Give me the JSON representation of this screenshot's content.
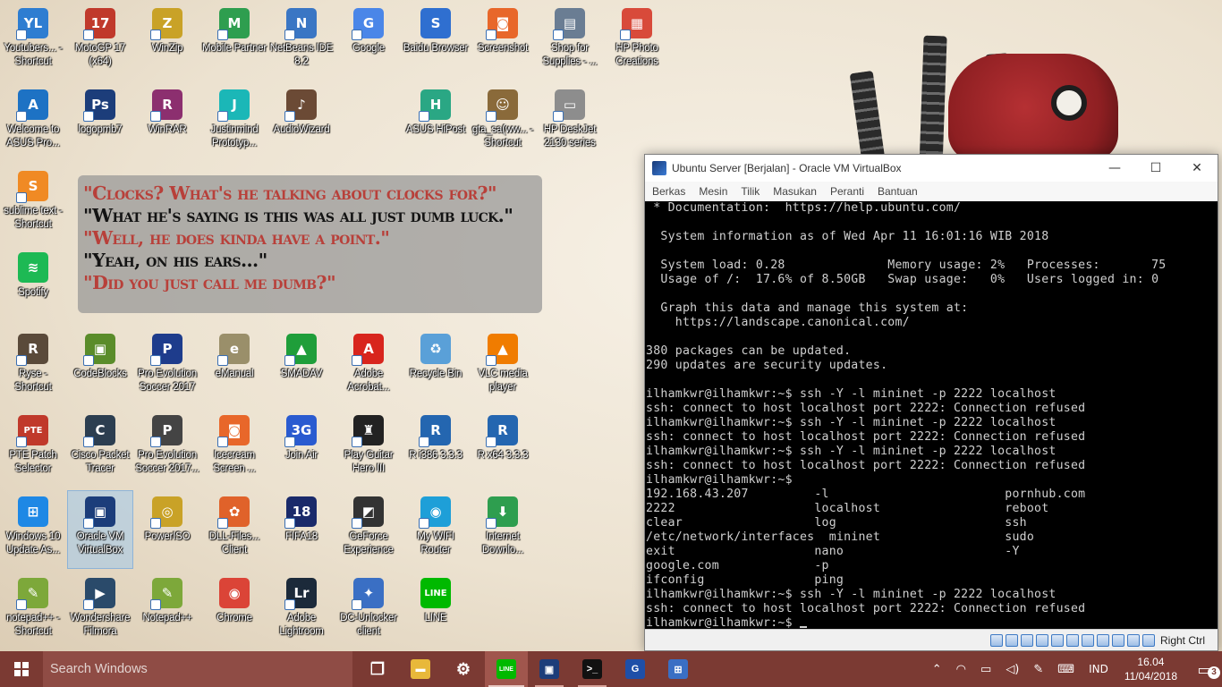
{
  "desktop_icons": [
    {
      "label": "Youtubers... - Shortcut",
      "glyph": "YL",
      "color": "#2e7dd1"
    },
    {
      "label": "MotoGP 17 (x64)",
      "glyph": "17",
      "color": "#c0392b"
    },
    {
      "label": "WinZip",
      "glyph": "Z",
      "color": "#c9a227"
    },
    {
      "label": "Mobile Partner",
      "glyph": "M",
      "color": "#2e9e4f"
    },
    {
      "label": "NetBeans IDE 8.2",
      "glyph": "N",
      "color": "#3a76c4"
    },
    {
      "label": "Google",
      "glyph": "G",
      "color": "#4a86e8"
    },
    {
      "label": "Baidu Browser",
      "glyph": "S",
      "color": "#2f6fd0"
    },
    {
      "label": "Screenshot",
      "glyph": "◙",
      "color": "#e8672a"
    },
    {
      "label": "Shop for Supplies - ...",
      "glyph": "▤",
      "color": "#6a7d93"
    },
    {
      "label": "HP Photo Creations",
      "glyph": "▦",
      "color": "#d84a3a"
    },
    {
      "label": "Welcome to ASUS Pro...",
      "glyph": "A",
      "color": "#1d72c4"
    },
    {
      "label": "logopmb7",
      "glyph": "Ps",
      "color": "#1c3d7a"
    },
    {
      "label": "WinRAR",
      "glyph": "R",
      "color": "#8c2f6f"
    },
    {
      "label": "Justinmind Prototyp...",
      "glyph": "J",
      "color": "#1bb7b7"
    },
    {
      "label": "AudioWizard",
      "glyph": "♪",
      "color": "#6b4a35"
    },
    {
      "label": "ASUS HiPost",
      "glyph": "H",
      "color": "#2aa784"
    },
    {
      "label": "gta_sa(ww... - Shortcut",
      "glyph": "☺",
      "color": "#8a6a3a"
    },
    {
      "label": "HP DeskJet 2130 series",
      "glyph": "▭",
      "color": "#8d8d8d"
    },
    {
      "label": "sublime text - Shortcut",
      "glyph": "S",
      "color": "#f08a24"
    },
    {
      "label": "Spotify",
      "glyph": "≋",
      "color": "#1db954"
    },
    {
      "label": "Ryse - Shortcut",
      "glyph": "R",
      "color": "#5a4a3a"
    },
    {
      "label": "CodeBlocks",
      "glyph": "▣",
      "color": "#5a8c2a"
    },
    {
      "label": "Pro Evolution Soccer 2017",
      "glyph": "P",
      "color": "#1e3c8c"
    },
    {
      "label": "eManual",
      "glyph": "e",
      "color": "#9a8f6a"
    },
    {
      "label": "SMADAV",
      "glyph": "▲",
      "color": "#1f9e3a"
    },
    {
      "label": "Adobe Acrobat...",
      "glyph": "A",
      "color": "#d8251d"
    },
    {
      "label": "Recycle Bin",
      "glyph": "♻",
      "color": "#5aa0d8"
    },
    {
      "label": "VLC media player",
      "glyph": "▲",
      "color": "#f07c00"
    },
    {
      "label": "PTE Patch Selector",
      "glyph": "PTE",
      "color": "#c0392b"
    },
    {
      "label": "Cisco Packet Tracer",
      "glyph": "C",
      "color": "#2c3e50"
    },
    {
      "label": "Pro Evolution Soccer 2017...",
      "glyph": "P",
      "color": "#444"
    },
    {
      "label": "Icecream Screen ...",
      "glyph": "◙",
      "color": "#e8672a"
    },
    {
      "label": "Join Air",
      "glyph": "3G",
      "color": "#2a5bd0"
    },
    {
      "label": "Play Guitar Hero III",
      "glyph": "♜",
      "color": "#222"
    },
    {
      "label": "R i386 3.3.3",
      "glyph": "R",
      "color": "#2466b0"
    },
    {
      "label": "R x64 3.3.3",
      "glyph": "R",
      "color": "#2466b0"
    },
    {
      "label": "Windows 10 Update As...",
      "glyph": "⊞",
      "color": "#1e88e5"
    },
    {
      "label": "Oracle VM VirtualBox",
      "glyph": "▣",
      "color": "#1c3d7a"
    },
    {
      "label": "PowerISO",
      "glyph": "◎",
      "color": "#c9a227"
    },
    {
      "label": "DLL-Files... Client",
      "glyph": "✿",
      "color": "#e0622a"
    },
    {
      "label": "FIFA18",
      "glyph": "18",
      "color": "#1a2a6a"
    },
    {
      "label": "GeForce Experience",
      "glyph": "◩",
      "color": "#333"
    },
    {
      "label": "My WIFI Router",
      "glyph": "◉",
      "color": "#1e9fd8"
    },
    {
      "label": "Internet Downlo...",
      "glyph": "⬇",
      "color": "#2e9e4f"
    },
    {
      "label": "notepad++ - Shortcut",
      "glyph": "✎",
      "color": "#7da83a"
    },
    {
      "label": "Wondershare Filmora",
      "glyph": "▶",
      "color": "#2a4a6a"
    },
    {
      "label": "Notepad++",
      "glyph": "✎",
      "color": "#7da83a"
    },
    {
      "label": "Chrome",
      "glyph": "◉",
      "color": "#db4437"
    },
    {
      "label": "Adobe Lightroom",
      "glyph": "Lr",
      "color": "#1c2a3a"
    },
    {
      "label": "DC-Unlocker client",
      "glyph": "✦",
      "color": "#3a6fc4"
    },
    {
      "label": "LINE",
      "glyph": "LINE",
      "color": "#00b900"
    }
  ],
  "quote_lines": [
    {
      "text": "\"Clocks? What's he talking about clocks for?\"",
      "tone": "red"
    },
    {
      "text": "\"What he's saying is this was all just dumb luck.\"",
      "tone": "black"
    },
    {
      "text": "\"Well, he does kinda have a point.\"",
      "tone": "red"
    },
    {
      "text": "\"Yeah, on his ears...\"",
      "tone": "black"
    },
    {
      "text": "\"Did you just call me dumb?\"",
      "tone": "red"
    }
  ],
  "vbox": {
    "title": "Ubuntu Server [Berjalan] - Oracle VM VirtualBox",
    "minimize": "—",
    "maximize": "☐",
    "close": "✕",
    "menu": [
      "Berkas",
      "Mesin",
      "Tilik",
      "Masukan",
      "Peranti",
      "Bantuan"
    ],
    "terminal_lines": [
      " * Documentation:  https://help.ubuntu.com/",
      "",
      "  System information as of Wed Apr 11 16:01:16 WIB 2018",
      "",
      "  System load: 0.28              Memory usage: 2%   Processes:       75",
      "  Usage of /:  17.6% of 8.50GB   Swap usage:   0%   Users logged in: 0",
      "",
      "  Graph this data and manage this system at:",
      "    https://landscape.canonical.com/",
      "",
      "380 packages can be updated.",
      "290 updates are security updates.",
      "",
      "ilhamkwr@ilhamkwr:~$ ssh -Y -l mininet -p 2222 localhost",
      "ssh: connect to host localhost port 2222: Connection refused",
      "ilhamkwr@ilhamkwr:~$ ssh -Y -l mininet -p 2222 localhost",
      "ssh: connect to host localhost port 2222: Connection refused",
      "ilhamkwr@ilhamkwr:~$ ssh -Y -l mininet -p 2222 localhost",
      "ssh: connect to host localhost port 2222: Connection refused",
      "ilhamkwr@ilhamkwr:~$",
      "192.168.43.207         -l                        pornhub.com",
      "2222                   localhost                 reboot",
      "clear                  log                       ssh",
      "/etc/network/interfaces  mininet                 sudo",
      "exit                   nano                      -Y",
      "google.com             -p",
      "ifconfig               ping",
      "ilhamkwr@ilhamkwr:~$ ssh -Y -l mininet -p 2222 localhost",
      "ssh: connect to host localhost port 2222: Connection refused"
    ],
    "prompt": "ilhamkwr@ilhamkwr:~$ ",
    "host_key": "Right Ctrl"
  },
  "taskbar": {
    "search_placeholder": "Search Windows",
    "apps": [
      {
        "name": "task-view",
        "glyph": "❐",
        "color": "transparent",
        "state": ""
      },
      {
        "name": "file-explorer",
        "glyph": "▬",
        "color": "#e8b83a",
        "state": ""
      },
      {
        "name": "settings",
        "glyph": "⚙",
        "color": "transparent",
        "state": ""
      },
      {
        "name": "line",
        "glyph": "LINE",
        "color": "#00b900",
        "state": "active"
      },
      {
        "name": "virtualbox",
        "glyph": "▣",
        "color": "#1c3d7a",
        "state": "open"
      },
      {
        "name": "command-prompt",
        "glyph": ">_",
        "color": "#111",
        "state": "open"
      },
      {
        "name": "pdf-app",
        "glyph": "G",
        "color": "#1e4fa8",
        "state": ""
      },
      {
        "name": "network-app",
        "glyph": "⊞",
        "color": "#3a6fc4",
        "state": ""
      }
    ],
    "tray": {
      "up_arrow": "⌃",
      "wifi": "◠",
      "battery": "▭",
      "volume": "◁)",
      "pen": "✎",
      "keyboard": "⌨",
      "language": "IND",
      "time": "16.04",
      "date": "11/04/2018",
      "notification_count": "3"
    }
  }
}
